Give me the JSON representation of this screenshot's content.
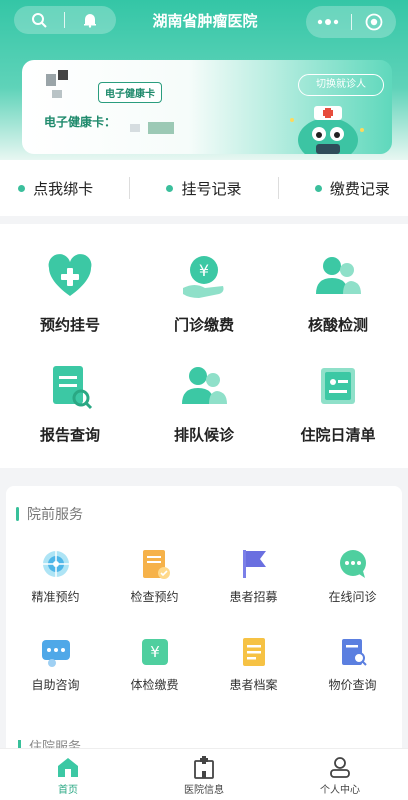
{
  "header": {
    "title": "湖南省肿瘤医院"
  },
  "card": {
    "badge": "电子健康卡",
    "label": "电子健康卡：",
    "switch_label": "切换就诊人"
  },
  "quick_links": [
    "点我绑卡",
    "挂号记录",
    "缴费记录"
  ],
  "main_grid": [
    {
      "label": "预约挂号",
      "icon": "heart-plus-icon"
    },
    {
      "label": "门诊缴费",
      "icon": "yen-hand-icon"
    },
    {
      "label": "核酸检测",
      "icon": "people-icon"
    },
    {
      "label": "报告查询",
      "icon": "report-search-icon"
    },
    {
      "label": "排队候诊",
      "icon": "people-icon"
    },
    {
      "label": "住院日清单",
      "icon": "scroll-icon"
    }
  ],
  "services": {
    "title": "院前服务",
    "items": [
      {
        "label": "精准预约",
        "icon": "target-icon"
      },
      {
        "label": "检查预约",
        "icon": "checklist-icon"
      },
      {
        "label": "患者招募",
        "icon": "flag-icon"
      },
      {
        "label": "在线问诊",
        "icon": "chat-bubble-icon"
      },
      {
        "label": "自助咨询",
        "icon": "chat-icon"
      },
      {
        "label": "体检缴费",
        "icon": "yen-card-icon"
      },
      {
        "label": "患者档案",
        "icon": "file-icon"
      },
      {
        "label": "物价查询",
        "icon": "doc-search-icon"
      }
    ],
    "next_section": "住院服务"
  },
  "tabbar": [
    {
      "label": "首页",
      "icon": "home-icon",
      "active": true
    },
    {
      "label": "医院信息",
      "icon": "hospital-icon",
      "active": false
    },
    {
      "label": "个人中心",
      "icon": "user-icon",
      "active": false
    }
  ]
}
